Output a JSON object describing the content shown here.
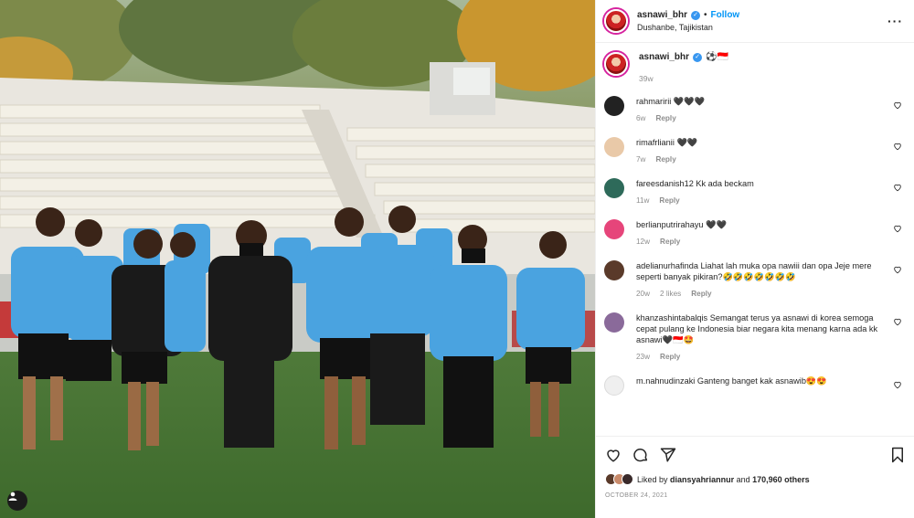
{
  "post": {
    "username": "asnawi_bhr",
    "location": "Dushanbe, Tajikistan",
    "follow_label": "Follow",
    "caption": "⚽🇮🇩",
    "caption_age": "39w",
    "liked_by_prefix": "Liked by",
    "liked_by_user": "diansyahriannur",
    "liked_by_and": "and",
    "liked_by_others": "170,960 others",
    "date": "OCTOBER 24, 2021"
  },
  "comments": [
    {
      "user": "rahmaririi",
      "text": "🖤🖤🖤",
      "age": "6w",
      "likes": "",
      "reply": "Reply"
    },
    {
      "user": "rimafrlianii",
      "text": "🖤🖤",
      "age": "7w",
      "likes": "",
      "reply": "Reply"
    },
    {
      "user": "fareesdanish12",
      "text": "Kk ada beckam",
      "age": "11w",
      "likes": "",
      "reply": "Reply"
    },
    {
      "user": "berlianputrirahayu",
      "text": "🖤🖤",
      "age": "12w",
      "likes": "",
      "reply": "Reply"
    },
    {
      "user": "adelianurhafinda",
      "text": "Liahat lah muka opa nawiii dan opa Jeje mere seperti banyak pikiran?🤣🤣🤣🤣🤣🤣🤣",
      "age": "20w",
      "likes": "2 likes",
      "reply": "Reply"
    },
    {
      "user": "khanzashintabalqis",
      "text": "Semangat terus ya asnawi di korea semoga cepat pulang ke Indonesia biar negara kita menang karna ada kk asnawi🖤🇮🇩🤩",
      "age": "23w",
      "likes": "",
      "reply": "Reply"
    },
    {
      "user": "m.nahnudinzaki",
      "text": "Ganteng banget kak asnawib😍😍",
      "age": "",
      "likes": "",
      "reply": ""
    }
  ],
  "icons": {
    "more": "more-options-icon",
    "heart": "heart-icon",
    "comment": "comment-icon",
    "share": "share-icon",
    "save": "bookmark-icon",
    "tag": "user-tag-icon"
  },
  "colors": {
    "accent": "#0095f6",
    "verified": "#3897f0",
    "muted": "#8e8e8e"
  }
}
